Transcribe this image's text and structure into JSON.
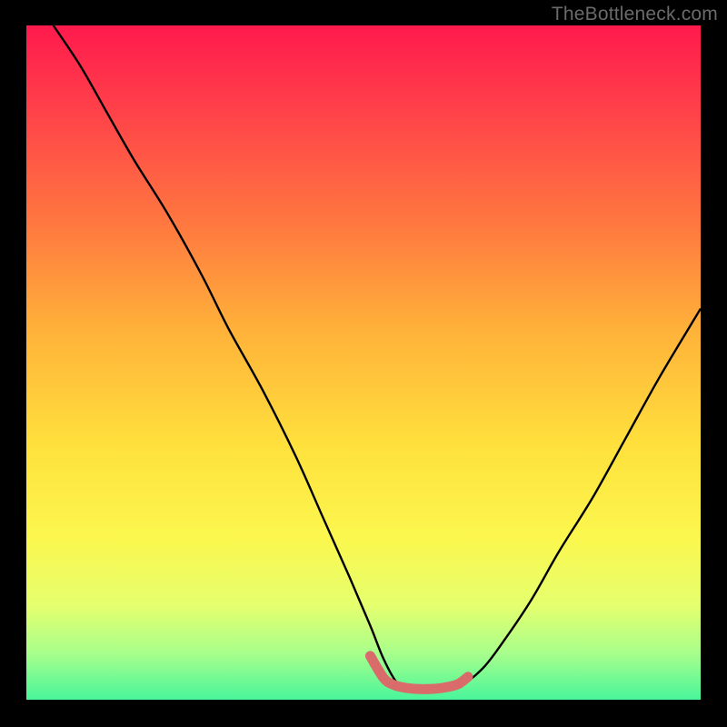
{
  "watermark": "TheBottleneck.com",
  "chart_data": {
    "type": "line",
    "title": "",
    "xlabel": "",
    "ylabel": "",
    "xlim": [
      0,
      100
    ],
    "ylim": [
      0,
      100
    ],
    "series": [
      {
        "name": "curve",
        "x": [
          4,
          8,
          12,
          16,
          21,
          26,
          30,
          35,
          40,
          44,
          48,
          51,
          53,
          55,
          57,
          59,
          61,
          63,
          65,
          68,
          71,
          75,
          79,
          84,
          89,
          94,
          100
        ],
        "y": [
          100,
          94,
          87,
          80,
          72,
          63,
          55,
          46,
          36,
          27,
          18,
          11,
          6,
          2.5,
          1.7,
          1.4,
          1.4,
          1.6,
          2.4,
          5,
          9,
          15,
          22,
          30,
          39,
          48,
          58
        ]
      }
    ],
    "accent_segment": {
      "note": "thick coral highlight near trough",
      "x": [
        51,
        53,
        54.5,
        56,
        58,
        60,
        62,
        64,
        65.5
      ],
      "y": [
        6.5,
        3.2,
        2.2,
        1.8,
        1.6,
        1.6,
        1.8,
        2.3,
        3.4
      ]
    },
    "colors": {
      "curve": "#000000",
      "accent": "#d96b6b",
      "gradient_top": "#ff1a4d",
      "gradient_bottom": "#49f59b",
      "frame": "#000000"
    }
  }
}
